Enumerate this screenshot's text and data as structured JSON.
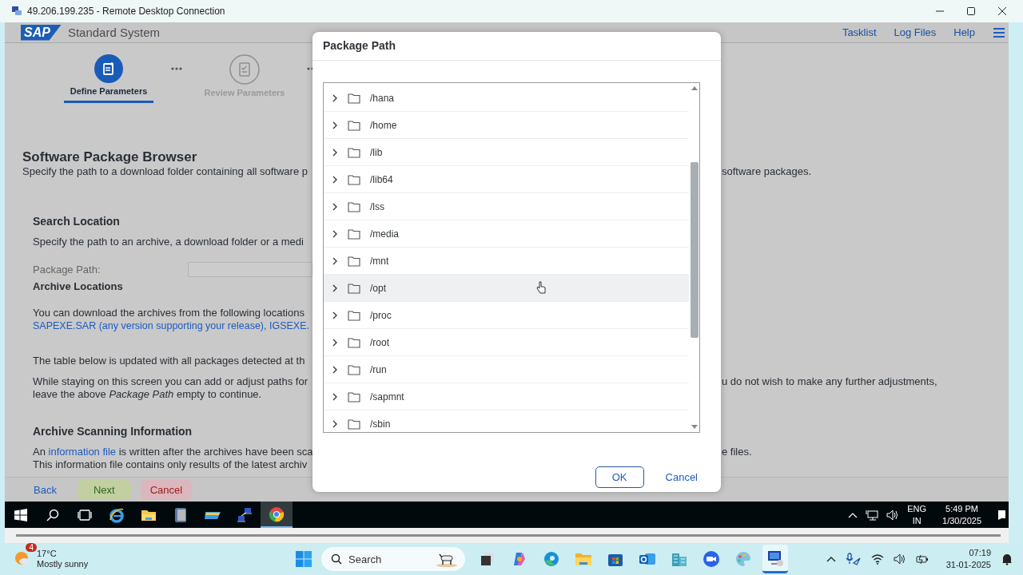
{
  "window": {
    "title": "49.206.199.235 - Remote Desktop Connection"
  },
  "header": {
    "logo": "SAP",
    "title": "Standard System",
    "links": [
      "Tasklist",
      "Log Files",
      "Help"
    ]
  },
  "steps": [
    {
      "label": "Define Parameters",
      "selected": true
    },
    {
      "label": "Review Parameters",
      "selected": false
    }
  ],
  "page": {
    "title": "Software Package Browser",
    "intro": "Specify the path to a download folder containing all software p",
    "intro_right": "software packages.",
    "search_location": {
      "heading": "Search Location",
      "text": "Specify the path to an archive, a download folder or a medi",
      "field_label": "Package Path:"
    },
    "archive_locations": {
      "heading": "Archive Locations",
      "text": "You can download the archives from the following locations",
      "link": "SAPEXE.SAR (any version supporting your release), IGSEXE.",
      "table_text": "The table below is updated with all packages detected at th",
      "adjust_text": "While staying on this screen you can add or adjust paths for",
      "adjust_right": "u do not wish to make any further adjustments,",
      "leave_text": "leave the above *Package Path* empty to continue."
    },
    "scanning": {
      "heading": "Archive Scanning Information",
      "text_before": "An",
      "link": "information file",
      "text_after": "is written after the archives have been sca",
      "text_right": "e files.",
      "text2": "This information file contains only results of the latest archiv"
    }
  },
  "footer_buttons": [
    {
      "label": "Back",
      "kind": "link"
    },
    {
      "label": "Next",
      "kind": "accept"
    },
    {
      "label": "Cancel",
      "kind": "reject"
    }
  ],
  "dialog": {
    "title": "Package Path",
    "folders": [
      {
        "name": "/hana",
        "expanded": false,
        "selected": false
      },
      {
        "name": "/home",
        "expanded": false,
        "selected": false
      },
      {
        "name": "/lib",
        "expanded": false,
        "selected": false
      },
      {
        "name": "/lib64",
        "expanded": false,
        "selected": false
      },
      {
        "name": "/lss",
        "expanded": false,
        "selected": false
      },
      {
        "name": "/media",
        "expanded": false,
        "selected": false
      },
      {
        "name": "/mnt",
        "expanded": false,
        "selected": false
      },
      {
        "name": "/opt",
        "expanded": false,
        "selected": true
      },
      {
        "name": "/proc",
        "expanded": false,
        "selected": false
      },
      {
        "name": "/root",
        "expanded": false,
        "selected": false
      },
      {
        "name": "/run",
        "expanded": false,
        "selected": false
      },
      {
        "name": "/sapmnt",
        "expanded": false,
        "selected": false
      },
      {
        "name": "/sbin",
        "expanded": false,
        "selected": false
      }
    ],
    "buttons": [
      {
        "label": "OK",
        "kind": "primary"
      },
      {
        "label": "Cancel",
        "kind": "plain"
      }
    ]
  },
  "remote_taskbar": {
    "apps": [
      {
        "kind": "start",
        "selected": false
      },
      {
        "kind": "search",
        "selected": false
      },
      {
        "kind": "taskview",
        "selected": false
      },
      {
        "kind": "ie",
        "selected": false
      },
      {
        "kind": "folder",
        "selected": false
      },
      {
        "kind": "device",
        "selected": false
      },
      {
        "kind": "swoosh",
        "selected": false
      },
      {
        "kind": "network",
        "selected": false
      },
      {
        "kind": "chrome",
        "selected": true
      }
    ],
    "language": "ENG",
    "region": "IN",
    "time": "5:49 PM",
    "date": "1/30/2025"
  },
  "host_taskbar": {
    "weather_badge": "4",
    "temperature": "17°C",
    "weather": "Mostly sunny",
    "search_placeholder": "Search",
    "apps": [
      {
        "kind": "taskview",
        "selected": false
      },
      {
        "kind": "copilot",
        "selected": false
      },
      {
        "kind": "edge",
        "selected": false
      },
      {
        "kind": "folder",
        "selected": false
      },
      {
        "kind": "store",
        "selected": false
      },
      {
        "kind": "outlook",
        "selected": false
      },
      {
        "kind": "building",
        "selected": false
      },
      {
        "kind": "zoom",
        "selected": false
      },
      {
        "kind": "palette",
        "selected": false
      },
      {
        "kind": "rdp",
        "selected": true
      }
    ],
    "time": "07:19",
    "date": "31-01-2025"
  }
}
